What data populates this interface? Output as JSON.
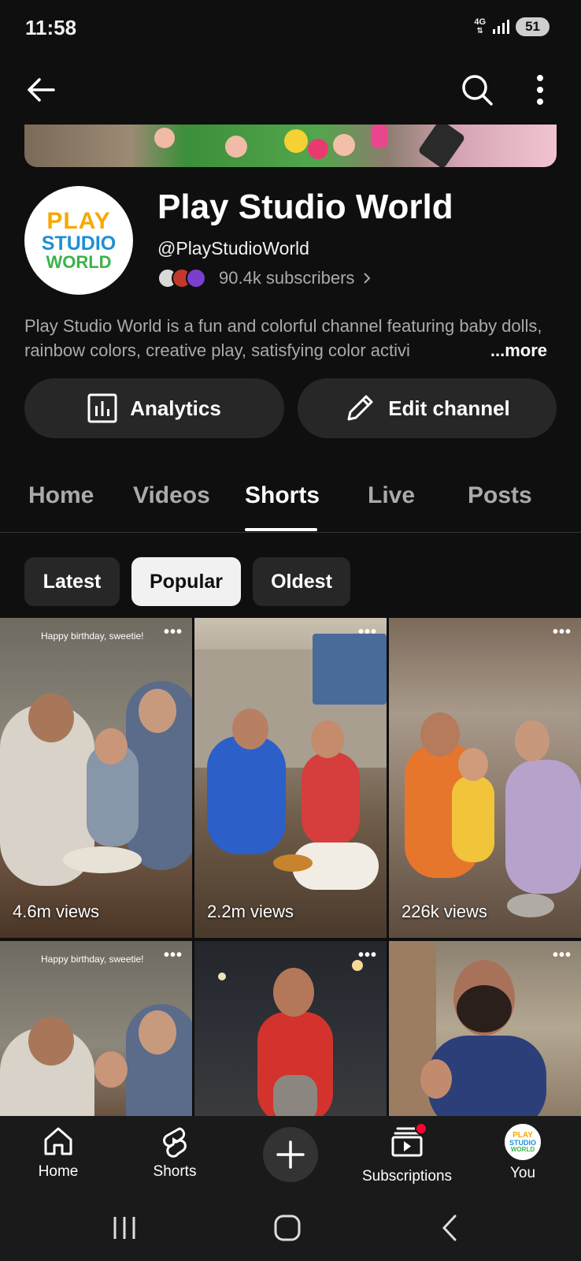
{
  "status": {
    "time": "11:58",
    "network": "4G",
    "battery": "51"
  },
  "channel": {
    "name": "Play Studio World",
    "handle": "@PlayStudioWorld",
    "subscribers": "90.4k subscribers",
    "description": "Play Studio World is a fun and colorful channel featuring baby dolls, rainbow colors, creative play, satisfying color activi",
    "more": "...more",
    "logo": {
      "line1": "PLAY",
      "line2": "STUDIO",
      "line3": "WORLD"
    }
  },
  "actions": {
    "analytics": "Analytics",
    "edit": "Edit channel"
  },
  "tabs": [
    "Home",
    "Videos",
    "Shorts",
    "Live",
    "Posts"
  ],
  "active_tab": "Shorts",
  "sort_chips": [
    "Latest",
    "Popular",
    "Oldest"
  ],
  "selected_chip": "Popular",
  "shorts": [
    {
      "views": "4.6m views",
      "caption": "Happy birthday, sweetie!"
    },
    {
      "views": "2.2m views",
      "caption": ""
    },
    {
      "views": "226k views",
      "caption": ""
    },
    {
      "views": "",
      "caption": "Happy birthday, sweetie!"
    },
    {
      "views": "",
      "caption": ""
    },
    {
      "views": "",
      "caption": ""
    }
  ],
  "bottom_nav": {
    "home": "Home",
    "shorts": "Shorts",
    "subscriptions": "Subscriptions",
    "you": "You"
  },
  "colors": {
    "background": "#0f0f0f",
    "chip_selected": "#f1f1f1",
    "button": "#272727",
    "notification": "#ff0033"
  }
}
